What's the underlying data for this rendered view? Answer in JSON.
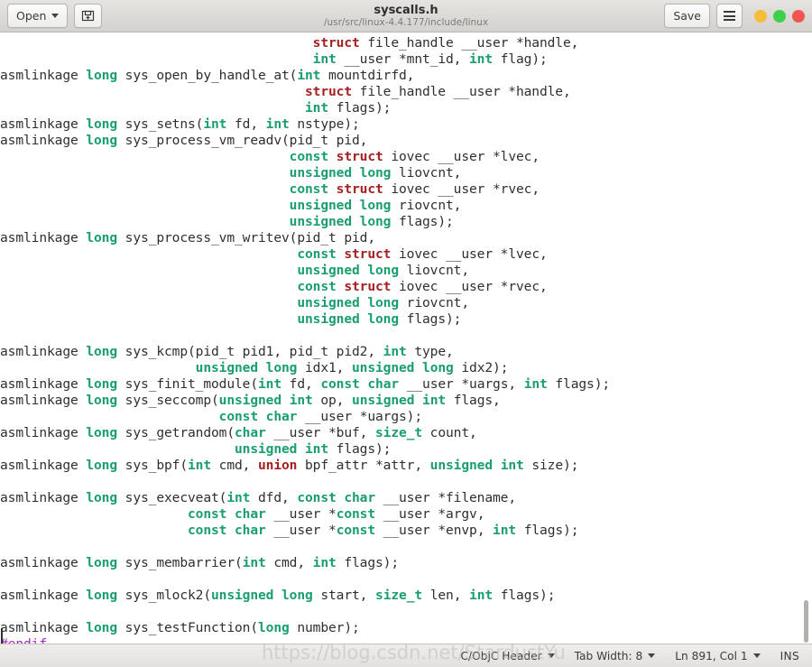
{
  "window": {
    "title": "syscalls.h",
    "subtitle": "/usr/src/linux-4.4.177/include/linux"
  },
  "toolbar": {
    "open_label": "Open",
    "open_icon": "chevron-down-icon",
    "new_document_icon": "new-document-icon",
    "save_label": "Save",
    "menu_icon": "hamburger-menu-icon",
    "minimize_icon": "minimize-window-button",
    "maximize_icon": "maximize-window-button",
    "close_icon": "close-window-button",
    "colors": {
      "minimize": "#f6bc3c",
      "maximize": "#3fd04a",
      "close": "#f0554f"
    }
  },
  "statusbar": {
    "language": "C/ObjC Header",
    "tab_width": "Tab Width: 8",
    "position": "Ln 891, Col 1",
    "insert_mode": "INS"
  },
  "watermark": {
    "text": "https://blog.csdn.net/StardustYu"
  },
  "editor": {
    "syntax_colors": {
      "keyword_type": "#1a9e6e",
      "keyword_struct": "#a52121",
      "preprocessor": "#a429c4",
      "identifier": "#2f2f2f",
      "background": "#ffffff"
    },
    "code": "                                        <k2>struct</k2> file_handle __user *handle,\n                                        <k>int</k> __user *mnt_id, <k>int</k> flag);\nasmlinkage <k>long</k> sys_open_by_handle_at(<k>int</k> mountdirfd,\n                                       <k2>struct</k2> file_handle __user *handle,\n                                       <k>int</k> flags);\nasmlinkage <k>long</k> sys_setns(<k>int</k> fd, <k>int</k> nstype);\nasmlinkage <k>long</k> sys_process_vm_readv(pid_t pid,\n                                     <k>const</k> <k2>struct</k2> iovec __user *lvec,\n                                     <k>unsigned</k> <k>long</k> liovcnt,\n                                     <k>const</k> <k2>struct</k2> iovec __user *rvec,\n                                     <k>unsigned</k> <k>long</k> riovcnt,\n                                     <k>unsigned</k> <k>long</k> flags);\nasmlinkage <k>long</k> sys_process_vm_writev(pid_t pid,\n                                      <k>const</k> <k2>struct</k2> iovec __user *lvec,\n                                      <k>unsigned</k> <k>long</k> liovcnt,\n                                      <k>const</k> <k2>struct</k2> iovec __user *rvec,\n                                      <k>unsigned</k> <k>long</k> riovcnt,\n                                      <k>unsigned</k> <k>long</k> flags);\n\nasmlinkage <k>long</k> sys_kcmp(pid_t pid1, pid_t pid2, <k>int</k> type,\n                         <k>unsigned</k> <k>long</k> idx1, <k>unsigned</k> <k>long</k> idx2);\nasmlinkage <k>long</k> sys_finit_module(<k>int</k> fd, <k>const</k> <k>char</k> __user *uargs, <k>int</k> flags);\nasmlinkage <k>long</k> sys_seccomp(<k>unsigned</k> <k>int</k> op, <k>unsigned</k> <k>int</k> flags,\n                            <k>const</k> <k>char</k> __user *uargs);\nasmlinkage <k>long</k> sys_getrandom(<k>char</k> __user *buf, <k>size_t</k> count,\n                              <k>unsigned</k> <k>int</k> flags);\nasmlinkage <k>long</k> sys_bpf(<k>int</k> cmd, <k2>union</k2> bpf_attr *attr, <k>unsigned</k> <k>int</k> size);\n\nasmlinkage <k>long</k> sys_execveat(<k>int</k> dfd, <k>const</k> <k>char</k> __user *filename,\n                        <k>const</k> <k>char</k> __user *<k>const</k> __user *argv,\n                        <k>const</k> <k>char</k> __user *<k>const</k> __user *envp, <k>int</k> flags);\n\nasmlinkage <k>long</k> sys_membarrier(<k>int</k> cmd, <k>int</k> flags);\n\nasmlinkage <k>long</k> sys_mlock2(<k>unsigned</k> <k>long</k> start, <k>size_t</k> len, <k>int</k> flags);\n\nasmlinkage <k>long</k> sys_testFunction(<k>long</k> number);\n<pp>#endif</pp>"
  }
}
